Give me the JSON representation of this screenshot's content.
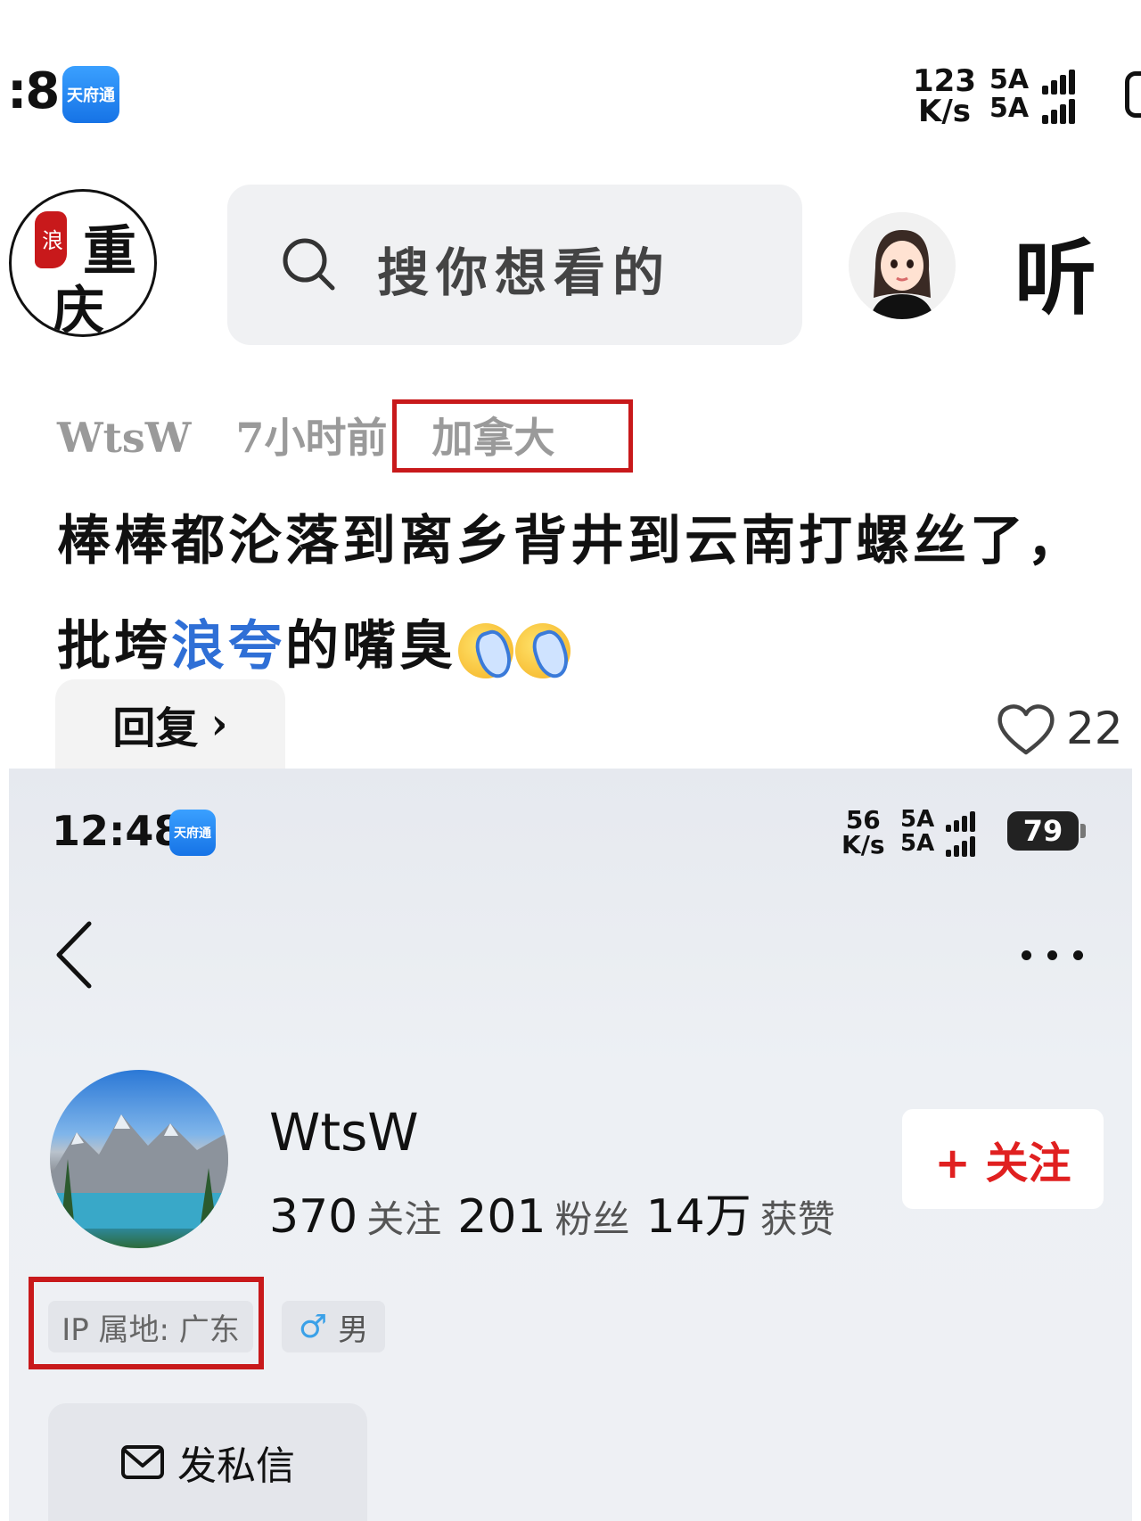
{
  "top_screenshot": {
    "status_bar": {
      "time_partial": ":8",
      "app_badge": "天府通",
      "net_speed_value": "123",
      "net_speed_unit": "K/s",
      "signal_1": "5A",
      "signal_2": "5A"
    },
    "header": {
      "logo_seal": "浪",
      "logo_text_1": "重",
      "logo_text_2": "庆",
      "search_placeholder": "搜你想看的",
      "listen_label": "听"
    },
    "comment": {
      "username": "WtsW",
      "time_ago": "7小时前",
      "location": "加拿大",
      "line1": "棒棒都沦落到离乡背井到云南打螺丝了，",
      "line2_prefix": "批垮",
      "line2_highlight": "浪夸",
      "line2_suffix": "的嘴臭",
      "reply_label": "回复",
      "reply_chevron": "›",
      "like_count": "22"
    }
  },
  "bottom_screenshot": {
    "status_bar": {
      "time": "12:48",
      "app_badge": "天府通",
      "net_speed_value": "56",
      "net_speed_unit": "K/s",
      "signal_1": "5A",
      "signal_2": "5A",
      "battery": "79"
    },
    "profile": {
      "name": "WtsW",
      "following_count": "370",
      "following_label": "关注",
      "followers_count": "201",
      "followers_label": "粉丝",
      "likes_count": "14万",
      "likes_label": "获赞",
      "follow_button": "+ 关注",
      "ip_location": "IP 属地: 广东",
      "gender_symbol": "♂",
      "gender": "男",
      "message_button": "发私信"
    }
  },
  "colors": {
    "highlight_box": "#c8191b",
    "link_blue": "#2f6fd6",
    "follow_red": "#e02020"
  }
}
